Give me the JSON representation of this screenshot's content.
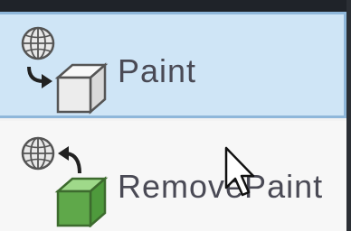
{
  "menu": {
    "items": [
      {
        "label": "Paint",
        "icon": "paint-face-icon",
        "selected": true
      },
      {
        "label": "RemovePaint",
        "icon": "remove-paint-icon",
        "selected": false
      }
    ]
  },
  "colors": {
    "selected_background": "#cfe5f6",
    "selected_border": "#8fb7da",
    "label_text": "#4a4a55",
    "green_cube": "#5fa84a"
  },
  "cursor": {
    "icon": "arrow-cursor-icon"
  }
}
